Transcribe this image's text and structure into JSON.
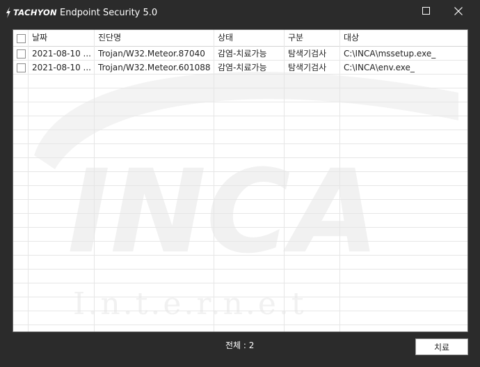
{
  "window": {
    "brand": "TACHYON",
    "title": "Endpoint Security 5.0"
  },
  "table": {
    "headers": [
      "날짜",
      "진단명",
      "상태",
      "구분",
      "대상"
    ],
    "rows": [
      {
        "date": "2021-08-10 ...",
        "diagnosis": "Trojan/W32.Meteor.87040",
        "status": "감염-치료가능",
        "category": "탐색기검사",
        "target": "C:\\INCA\\mssetup.exe_"
      },
      {
        "date": "2021-08-10 ...",
        "diagnosis": "Trojan/W32.Meteor.601088",
        "status": "감염-치료가능",
        "category": "탐색기검사",
        "target": "C:\\INCA\\env.exe_"
      }
    ]
  },
  "watermark": {
    "logo": "INCA",
    "sub": "I.n.t.e.r.n.e.t"
  },
  "footer": {
    "total": "전체 : 2",
    "treat_button": "치료"
  },
  "colors": {
    "window_bg": "#2b2b2b",
    "panel_bg": "#ffffff",
    "grid_line": "#e6e6e6",
    "watermark": "#f2f2f2"
  }
}
